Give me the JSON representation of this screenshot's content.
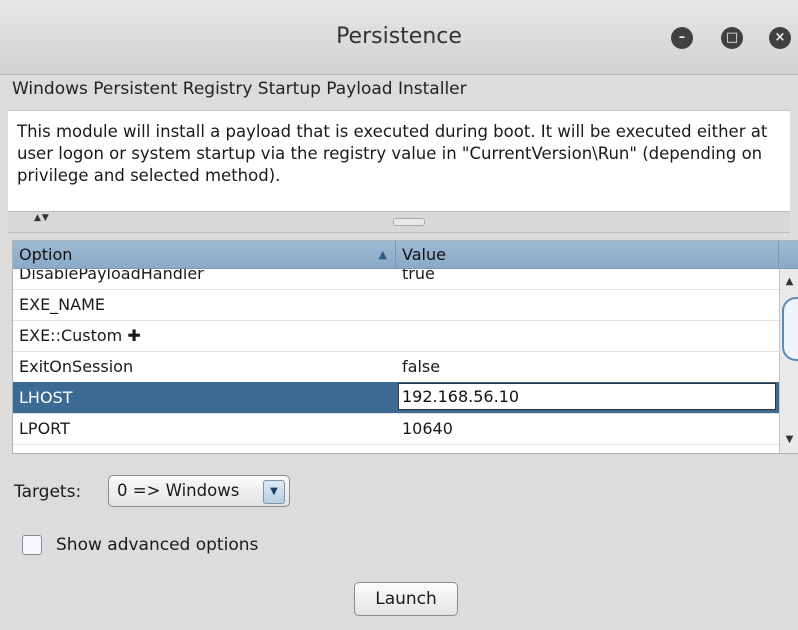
{
  "window": {
    "title": "Persistence",
    "buttons": {
      "minimize": "–",
      "maximize": "□",
      "close": "×"
    }
  },
  "module": {
    "name": "Windows Persistent Registry Startup Payload Installer",
    "description": "This module will install a payload that is executed during boot. It will be executed either at user logon or system startup via the registry value in \"CurrentVersion\\Run\" (depending on privilege and selected method)."
  },
  "splitter": {
    "arrows": "▲▼"
  },
  "table": {
    "columns": [
      "Option",
      "Value"
    ],
    "sort_indicator": "▲",
    "rows": [
      {
        "option": "DisablePayloadHandler",
        "value": "true"
      },
      {
        "option": "EXE_NAME",
        "value": ""
      },
      {
        "option": "EXE::Custom",
        "value": "",
        "expandable": true,
        "expand_glyph": "✚"
      },
      {
        "option": "ExitOnSession",
        "value": "false"
      },
      {
        "option": "LHOST",
        "value": "192.168.56.10",
        "selected": true,
        "editing": true
      },
      {
        "option": "LPORT",
        "value": "10640"
      }
    ],
    "scrollbar": {
      "up": "▲",
      "down": "▼"
    }
  },
  "targets": {
    "label": "Targets:",
    "selected": "0 => Windows",
    "arrow": "▼"
  },
  "advanced": {
    "label": "Show advanced options",
    "checked": false
  },
  "actions": {
    "launch_label": "Launch"
  },
  "colors": {
    "selection": "#3b6a92",
    "header": "#9ebad3",
    "background": "#dcdcdc"
  }
}
